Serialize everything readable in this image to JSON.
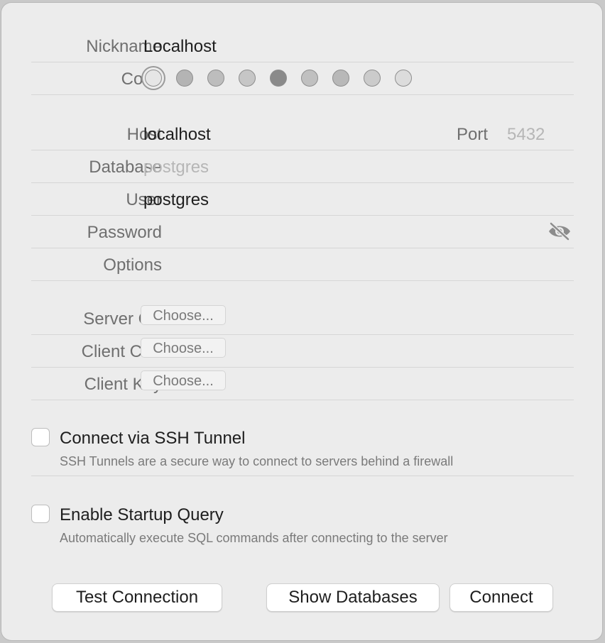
{
  "nickname": {
    "label": "Nickname",
    "value": "Localhost"
  },
  "color": {
    "label": "Color",
    "swatches": [
      "#e6e6e6",
      "#b4b4b4",
      "#bdbdbd",
      "#c6c6c6",
      "#8a8a8a",
      "#c0c0c0",
      "#b8b8b8",
      "#cbcbcb",
      "#dcdcdc"
    ],
    "selected_index": 0
  },
  "host": {
    "label": "Host",
    "value": "localhost"
  },
  "port": {
    "label": "Port",
    "placeholder": "5432"
  },
  "database": {
    "label": "Database",
    "placeholder": "postgres"
  },
  "user": {
    "label": "User",
    "value": "postgres"
  },
  "password": {
    "label": "Password",
    "value": ""
  },
  "options": {
    "label": "Options",
    "value": ""
  },
  "ssl": {
    "server_ca": {
      "label": "Server CA",
      "button": "Choose..."
    },
    "client_cert": {
      "label": "Client Cert",
      "button": "Choose..."
    },
    "client_key": {
      "label": "Client Key",
      "button": "Choose..."
    }
  },
  "ssh": {
    "checked": false,
    "title": "Connect via SSH Tunnel",
    "description": "SSH Tunnels are a secure way to connect to servers behind a firewall"
  },
  "startup": {
    "checked": false,
    "title": "Enable Startup Query",
    "description": "Automatically execute SQL commands after connecting to the server"
  },
  "buttons": {
    "test": "Test Connection",
    "show_databases": "Show Databases",
    "connect": "Connect"
  }
}
